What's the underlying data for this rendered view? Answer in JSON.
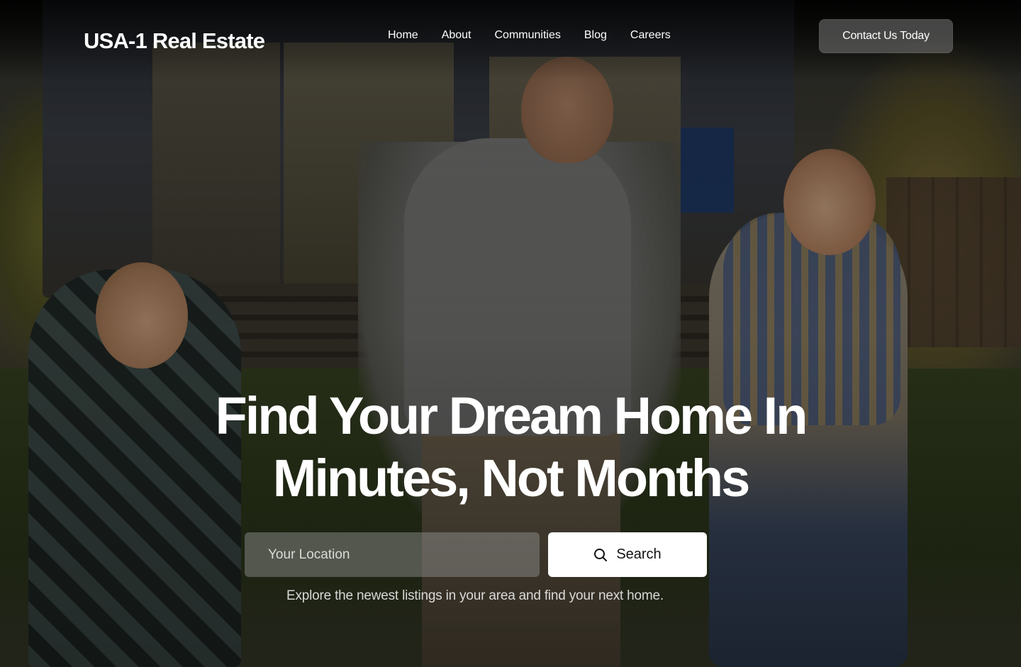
{
  "header": {
    "logo": "USA-1 Real Estate",
    "nav": [
      {
        "label": "Home"
      },
      {
        "label": "About"
      },
      {
        "label": "Communities"
      },
      {
        "label": "Blog"
      },
      {
        "label": "Careers"
      }
    ],
    "cta_label": "Contact Us Today"
  },
  "hero": {
    "headline_line1": "Find Your Dream Home In",
    "headline_line2": "Minutes, Not Months",
    "search": {
      "placeholder": "Your Location",
      "value": "",
      "button_label": "Search",
      "button_icon": "search-icon"
    },
    "subtext": "Explore the newest listings in your area and find your next home."
  },
  "colors": {
    "text": "#ffffff",
    "search_button_bg": "#ffffff",
    "search_button_text": "#111111",
    "cta_bg": "rgba(120,120,120,0.55)"
  }
}
